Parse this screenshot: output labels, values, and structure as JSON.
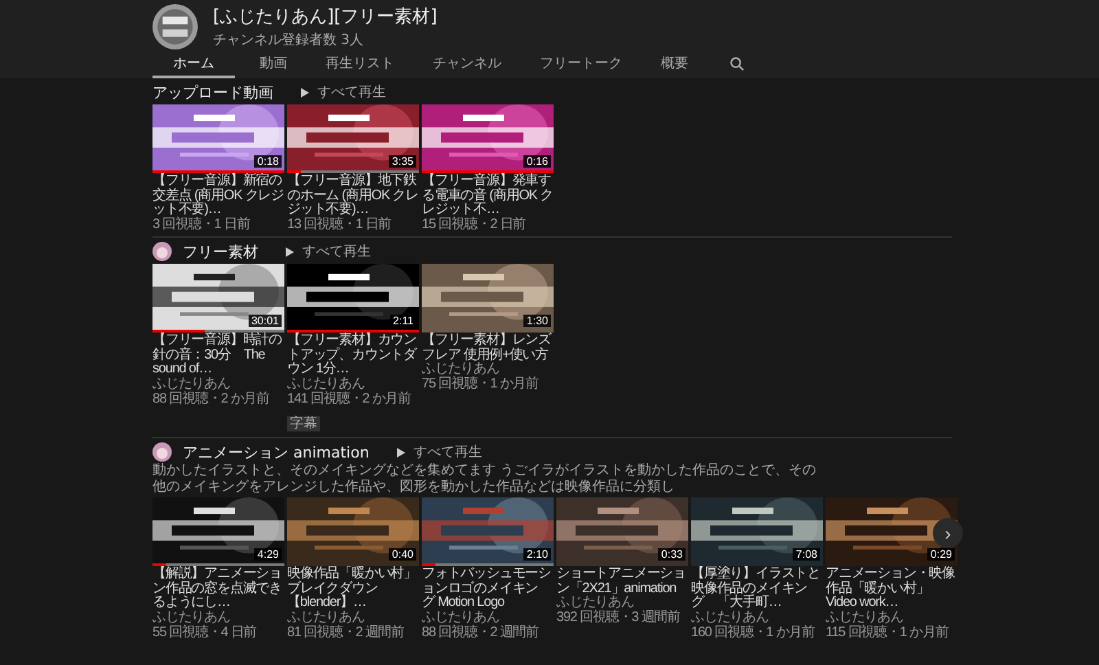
{
  "channel": {
    "name": "[ふじたりあん][フリー素材]",
    "subscribers": "チャンネル登録者数 3人"
  },
  "tabs": [
    {
      "label": "ホーム",
      "selected": true
    },
    {
      "label": "動画",
      "selected": false
    },
    {
      "label": "再生リスト",
      "selected": false
    },
    {
      "label": "チャンネル",
      "selected": false
    },
    {
      "label": "フリートーク",
      "selected": false
    },
    {
      "label": "概要",
      "selected": false
    }
  ],
  "sections": [
    {
      "title": "アップロード動画",
      "play_all": "すべて再生",
      "videos": [
        {
          "title": "【フリー音源】新宿の交差点 (商用OK クレジット不要)…",
          "duration": "0:18",
          "level": 1,
          "meta": "3 回視聴・1 日前"
        },
        {
          "title": "【フリー音源】地下鉄のホーム (商用OK クレジット不要)…",
          "duration": "3:35",
          "level": 0.1,
          "meta": "13 回視聴・1 日前"
        },
        {
          "title": "【フリー音源】発車する電車の音 (商用OK クレジット不…",
          "duration": "0:16",
          "level": 1,
          "meta": "15 回視聴・2 日前"
        }
      ]
    },
    {
      "title": "フリー素材",
      "avatar": true,
      "play_all": "すべて再生",
      "videos": [
        {
          "title": "【フリー音源】時計の針の音：30分　The sound of…",
          "duration": "30:01",
          "level": 0.4,
          "channel": "ふじたりあん",
          "meta": "88 回視聴・2 か月前"
        },
        {
          "title": "【フリー素材】カウントアップ、カウントダウン 1分…",
          "duration": "2:11",
          "level": 1,
          "channel": "ふじたりあん",
          "meta": "141 回視聴・2 か月前",
          "badge": "字幕"
        },
        {
          "title": "【フリー素材】レンズフレア 使用例+使い方",
          "duration": "1:30",
          "channel": "ふじたりあん",
          "meta": "75 回視聴・1 か月前"
        }
      ]
    },
    {
      "title": "アニメーション animation",
      "avatar": true,
      "play_all": "すべて再生",
      "description": "動かしたイラストと、そのメイキングなどを集めてます うごイラがイラストを動かした作品のことで、その他のメイキングをアレンジした作品や、図形を動かした作品などは映像作品に分類し",
      "videos": [
        {
          "title": "【解説】アニメーション作品の窓を点滅できるようにし…",
          "duration": "4:29",
          "level": 0.1,
          "channel": "ふじたりあん",
          "meta": "55 回視聴・4 日前"
        },
        {
          "title": "映像作品「暖かい村」ブレイクダウン【blender】…",
          "duration": "0:40",
          "channel": "ふじたりあん",
          "meta": "81 回視聴・2 週間前"
        },
        {
          "title": "フォトバッシュモーションロゴのメイキング Motion Logo",
          "duration": "2:10",
          "level": 0.1,
          "channel": "ふじたりあん",
          "meta": "88 回視聴・2 週間前"
        },
        {
          "title": "ショートアニメーション「2X21」animation",
          "duration": "0:33",
          "channel": "ふじたりあん",
          "meta": "392 回視聴・3 週間前"
        },
        {
          "title": "【厚塗り】イラストと映像作品のメイキング　「大手町…",
          "duration": "7:08",
          "channel": "ふじたりあん",
          "meta": "160 回視聴・1 か月前"
        },
        {
          "title": "アニメーション・映像作品「暖かい村」　Video work…",
          "duration": "0:29",
          "channel": "ふじたりあん",
          "meta": "115 回視聴・1 か月前"
        }
      ],
      "next_arrow": "›"
    }
  ]
}
